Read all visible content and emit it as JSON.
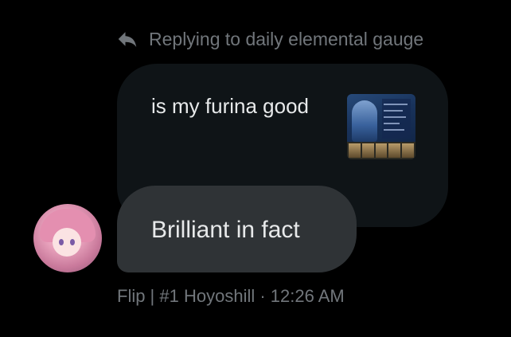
{
  "reply_context": {
    "text": "Replying to daily elemental gauge",
    "icon": "reply-arrow-icon"
  },
  "quoted_message": {
    "text": "is my furina good",
    "attachment": "image-thumbnail"
  },
  "message": {
    "text": "Brilliant in fact"
  },
  "meta": {
    "line": "Flip | #1 Hoyoshill · 12:26 AM"
  },
  "colors": {
    "background": "#000000",
    "muted_text": "#71767b",
    "primary_text": "#e7e9ea",
    "quoted_bubble": "#0f1417",
    "reply_bubble": "#2f3336"
  }
}
